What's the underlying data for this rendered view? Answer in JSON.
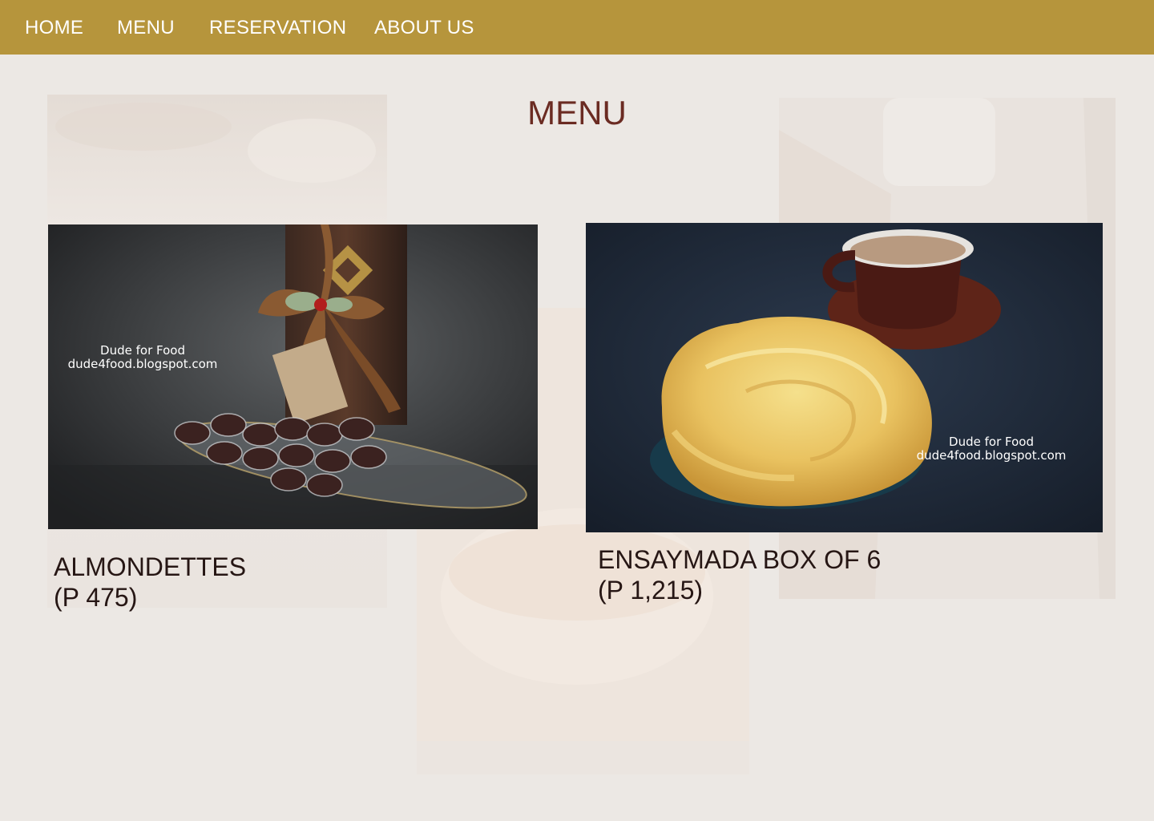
{
  "nav": {
    "items": [
      {
        "label": "HOME"
      },
      {
        "label": "MENU"
      },
      {
        "label": "RESERVATION"
      },
      {
        "label": "ABOUT US"
      }
    ]
  },
  "main": {
    "title": "MENU",
    "products": [
      {
        "name": "ALMONDETTES",
        "price": "(P 475)",
        "watermark_line1": "Dude for Food",
        "watermark_line2": "dude4food.blogspot.com"
      },
      {
        "name": "ENSAYMADA BOX OF 6",
        "price": "(P 1,215)",
        "watermark_line1": "Dude for Food",
        "watermark_line2": "dude4food.blogspot.com"
      }
    ]
  },
  "colors": {
    "nav_background": "#b6953c",
    "page_background": "#ece8e4",
    "title_color": "#6b2b22",
    "text_color": "#261614"
  }
}
